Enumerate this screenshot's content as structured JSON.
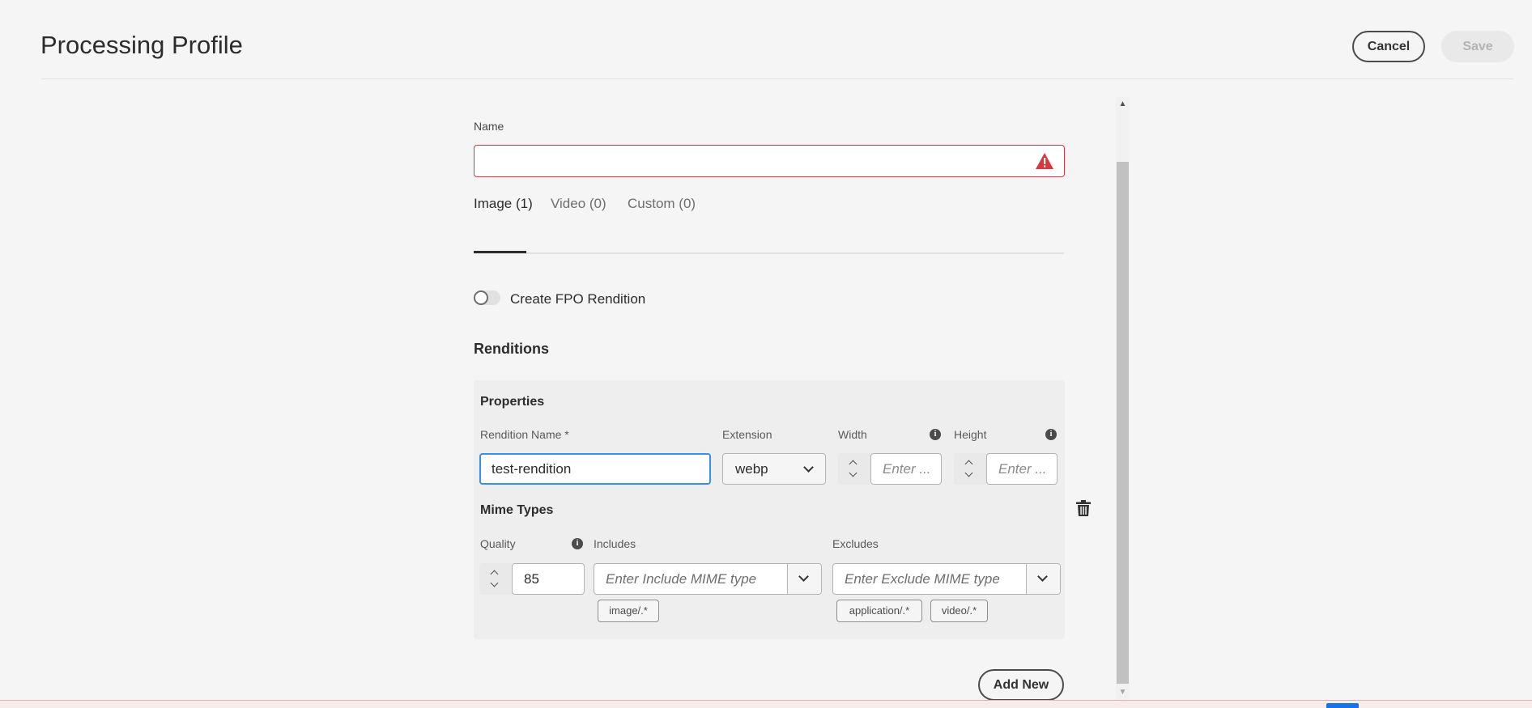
{
  "header": {
    "title": "Processing Profile",
    "cancel_label": "Cancel",
    "save_label": "Save"
  },
  "name_field": {
    "label": "Name",
    "value": ""
  },
  "tabs": [
    {
      "label": "Image (1)",
      "active": true
    },
    {
      "label": "Video (0)",
      "active": false
    },
    {
      "label": "Custom (0)",
      "active": false
    }
  ],
  "fpo_toggle": {
    "label": "Create FPO Rendition",
    "on": false
  },
  "renditions": {
    "title": "Renditions",
    "properties_title": "Properties",
    "rendition_name": {
      "label": "Rendition Name *",
      "value": "test-rendition"
    },
    "extension": {
      "label": "Extension",
      "value": "webp"
    },
    "width": {
      "label": "Width",
      "placeholder": "Enter ..."
    },
    "height": {
      "label": "Height",
      "placeholder": "Enter ..."
    },
    "mime_title": "Mime Types",
    "quality": {
      "label": "Quality",
      "value": "85"
    },
    "includes": {
      "label": "Includes",
      "placeholder": "Enter Include MIME type",
      "tags": [
        "image/.*"
      ]
    },
    "excludes": {
      "label": "Excludes",
      "placeholder": "Enter Exclude MIME type",
      "tags": [
        "application/.*",
        "video/.*"
      ]
    }
  },
  "add_new_label": "Add New",
  "colors": {
    "error": "#d7373f",
    "focus": "#378ef0",
    "background": "#f5f5f5"
  },
  "icons": [
    "alert-icon",
    "info-icon",
    "trash-icon",
    "chevron-down-icon"
  ]
}
